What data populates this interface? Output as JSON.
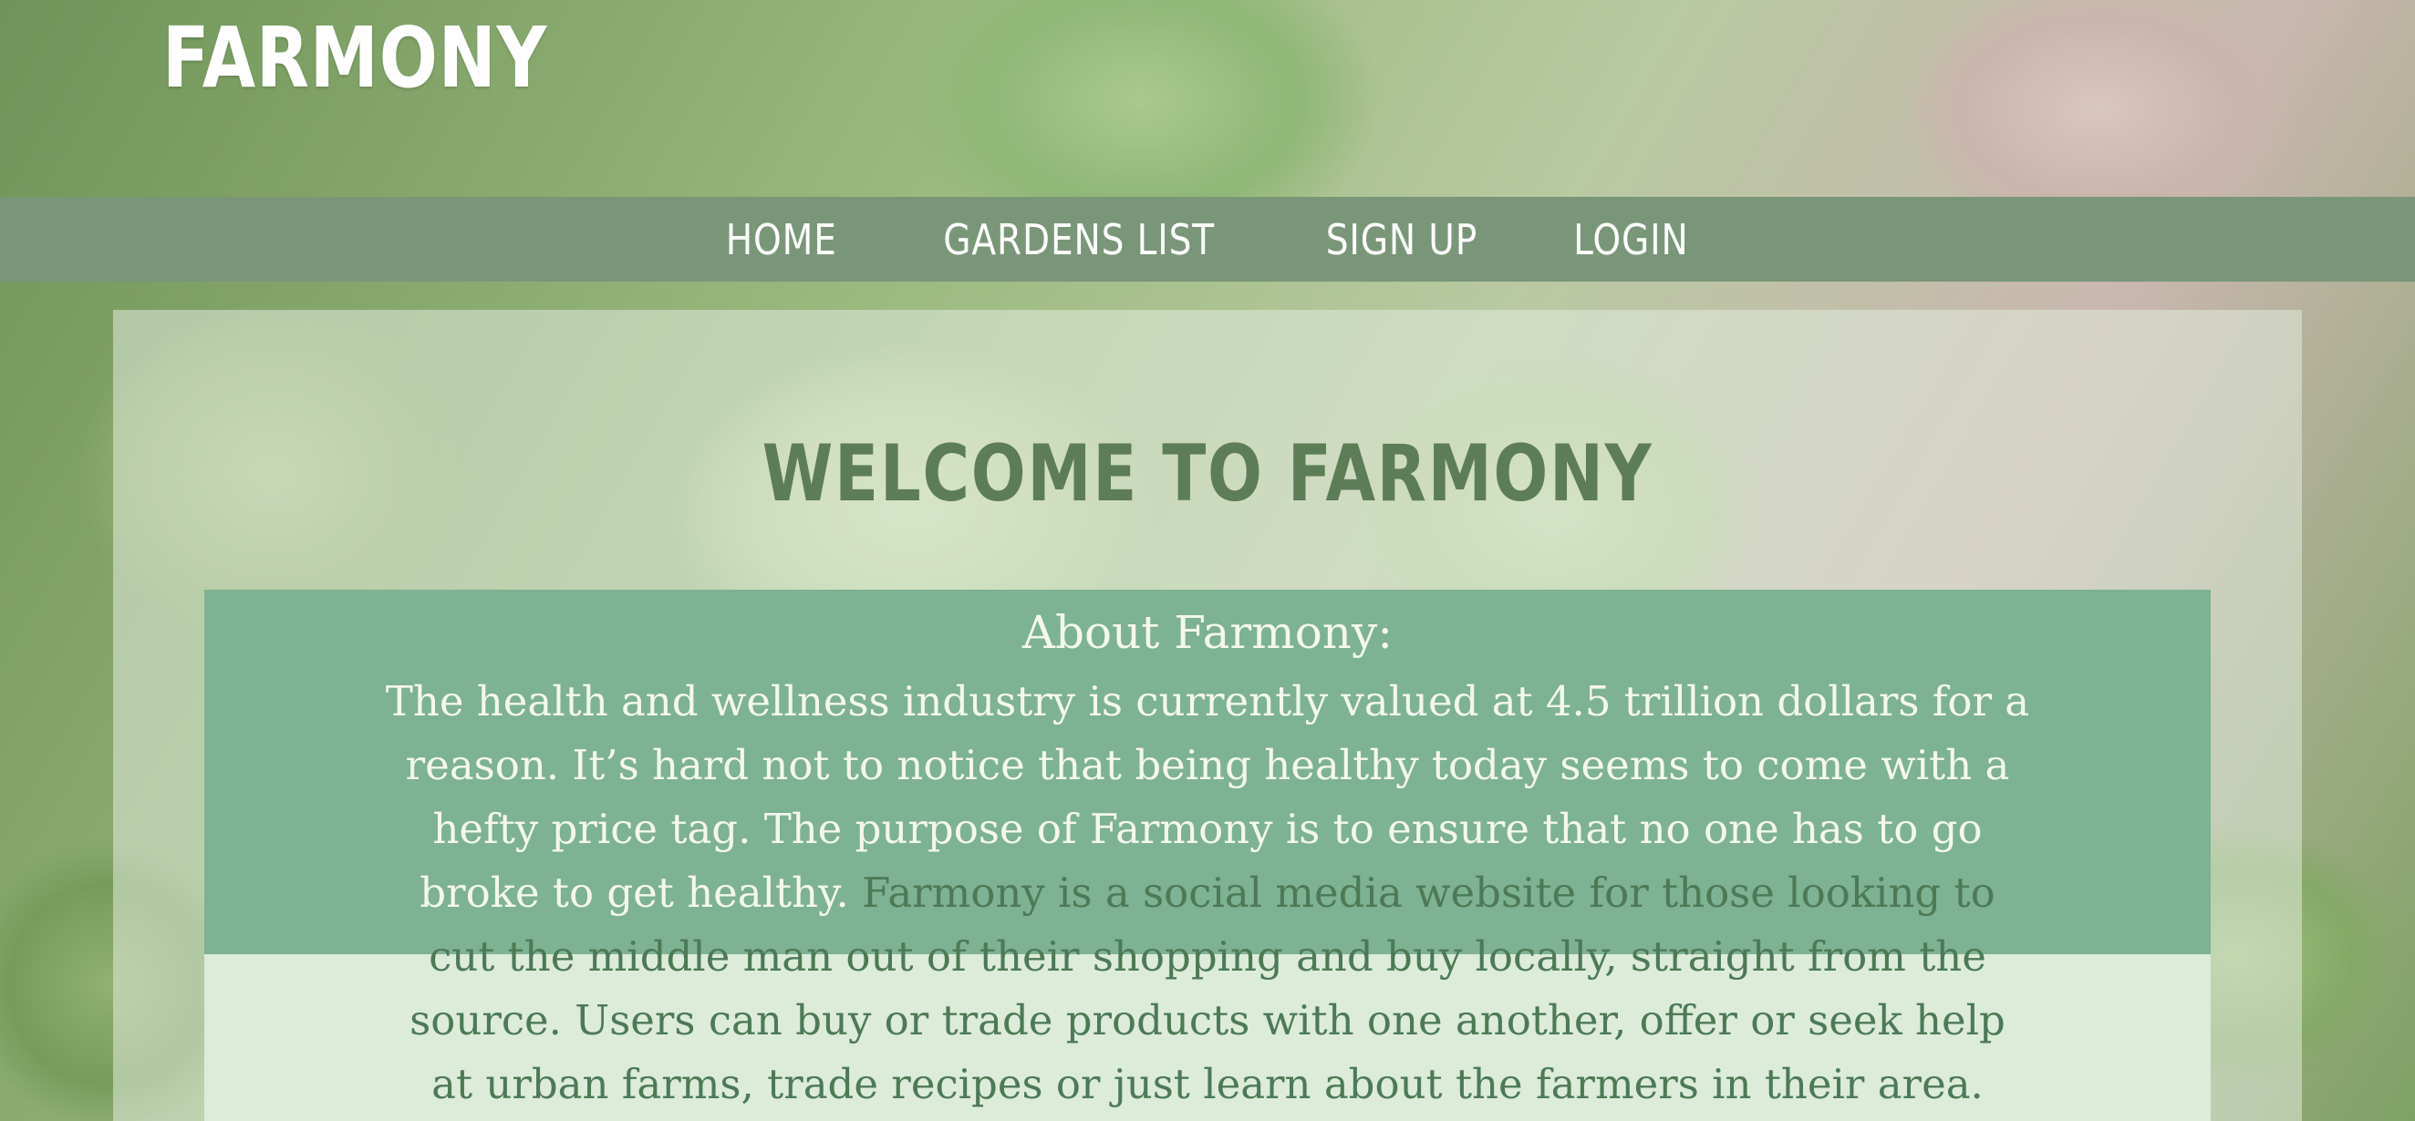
{
  "site": {
    "logo": "FARMONY"
  },
  "nav": {
    "items": [
      {
        "label": "HOME"
      },
      {
        "label": "GARDENS LIST"
      },
      {
        "label": "SIGN UP"
      },
      {
        "label": "LOGIN"
      }
    ]
  },
  "main": {
    "title": "WELCOME TO FARMONY",
    "about": {
      "heading": "About Farmony:",
      "paragraph_part1": "The health and wellness industry is currently valued at 4.5 trillion dollars for a reason. It’s hard not to notice that being healthy today seems to come with a hefty price tag. The purpose of Farmony is to ensure that no one has to go broke to get healthy.",
      "paragraph_part2": " Farmony is a social media website for those looking to cut the middle man out of their shopping and buy locally, straight from the source. Users can buy or trade products with one another, offer or seek help at urban farms, trade recipes or just learn about the farmers in their area."
    }
  },
  "colors": {
    "nav_bar": "#7a9679",
    "title": "#5d7d56",
    "about_box_top": "#7db292",
    "about_box_bottom": "#dcecd9",
    "panel": "#e1ebdc"
  }
}
